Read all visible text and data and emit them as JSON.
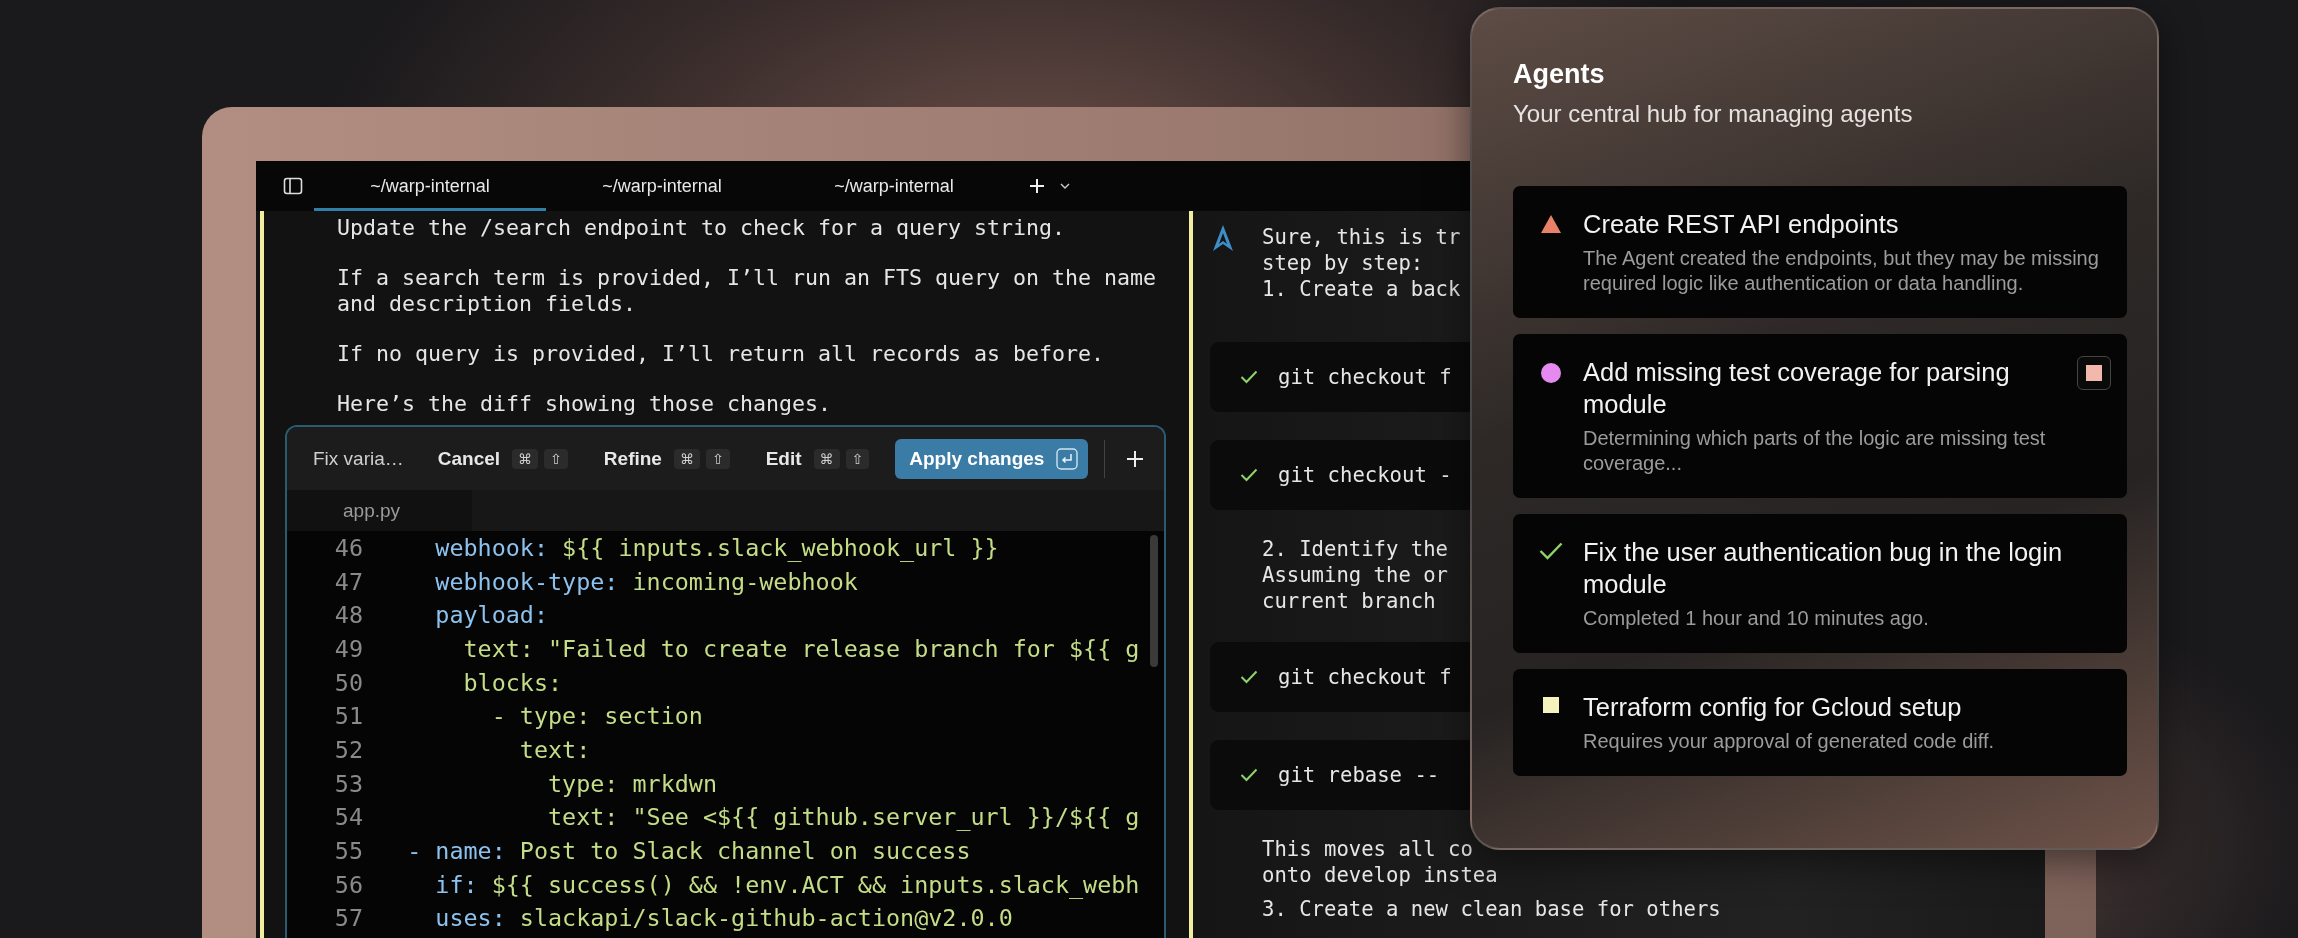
{
  "tab_bar": {
    "tabs": [
      {
        "label": "~/warp-internal",
        "selected": true
      },
      {
        "label": "~/warp-internal",
        "selected": false
      },
      {
        "label": "~/warp-internal",
        "selected": false
      }
    ]
  },
  "conversation": {
    "paragraphs": [
      "Update the /search endpoint to check for a query string.",
      "If a search term is provided, I’ll run an FTS query on the name and description fields.",
      "If no query is provided, I’ll return all records as before.",
      "Here’s the diff showing those changes."
    ]
  },
  "diff_panel": {
    "title": "Fix varia…",
    "actions": [
      {
        "kind": "plain",
        "label": "Cancel",
        "keys": [
          "⌘",
          "⇧"
        ]
      },
      {
        "kind": "plain",
        "label": "Refine",
        "keys": [
          "⌘",
          "⇧"
        ]
      },
      {
        "kind": "plain",
        "label": "Edit",
        "keys": [
          "⌘",
          "⇧"
        ]
      },
      {
        "kind": "primary",
        "label": "Apply changes"
      }
    ],
    "file_tab": "app.py",
    "lines": [
      {
        "number": "46",
        "key": "    webhook:",
        "value": " ${{ inputs.slack_webhook_url }}"
      },
      {
        "number": "47",
        "key": "    webhook-type:",
        "value": " incoming-webhook"
      },
      {
        "number": "48",
        "key": "    payload:"
      },
      {
        "number": "49",
        "value": "      text: \"Failed to create release branch for ${{ g"
      },
      {
        "number": "50",
        "value": "      blocks:"
      },
      {
        "number": "51",
        "value": "        - type: section"
      },
      {
        "number": "52",
        "value": "          text:"
      },
      {
        "number": "53",
        "value": "            type: mrkdwn"
      },
      {
        "number": "54",
        "value": "            text: \"See <${{ github.server_url }}/${{ g"
      },
      {
        "number": "55",
        "key": "  - name:",
        "value": " Post to Slack channel on success"
      },
      {
        "number": "56",
        "key": "    if:",
        "value": " ${{ success() && !env.ACT && inputs.slack_webh"
      },
      {
        "number": "57",
        "key": "    uses:",
        "value": " slackapi/slack-github-action@v2.0.0"
      }
    ]
  },
  "agent_response": {
    "items": [
      {
        "kind": "agent_text",
        "lines": [
          "Sure, this is tr",
          "step by step:",
          "1. Create a back"
        ]
      },
      {
        "kind": "command",
        "text": "git checkout f"
      },
      {
        "kind": "command",
        "text": "git checkout -"
      },
      {
        "kind": "text",
        "lines": [
          "2. Identify the",
          "Assuming the or",
          "current branch"
        ]
      },
      {
        "kind": "command",
        "text": "git checkout f"
      },
      {
        "kind": "command",
        "text": "git rebase --"
      },
      {
        "kind": "text",
        "lines": [
          "This moves all co",
          "onto develop instea"
        ]
      },
      {
        "kind": "text",
        "lines": [
          "3. Create a new clean base for others"
        ]
      }
    ]
  },
  "agents": {
    "title": "Agents",
    "subtitle": "Your central hub for managing agents",
    "items": [
      {
        "kind": "warning",
        "color": "#e8806a",
        "title": "Create REST API endpoints",
        "description": "The Agent created the endpoints, but they may be missing required logic like authentication or data handling.",
        "stop_button": false
      },
      {
        "kind": "running",
        "color": "#e68af2",
        "title": "Add missing test coverage for parsing module",
        "description": "Determining which parts of the logic are missing test coverage...",
        "stop_button": true
      },
      {
        "kind": "done",
        "color": "#8fd46a",
        "title": "Fix the user authentication bug in the login module",
        "description": "Completed 1 hour and 10 minutes ago.",
        "stop_button": false
      },
      {
        "kind": "pending",
        "color": "#f6f2c0",
        "title": "Terraform config for Gcloud setup",
        "description": "Requires your approval of generated code diff.",
        "stop_button": false
      }
    ]
  }
}
